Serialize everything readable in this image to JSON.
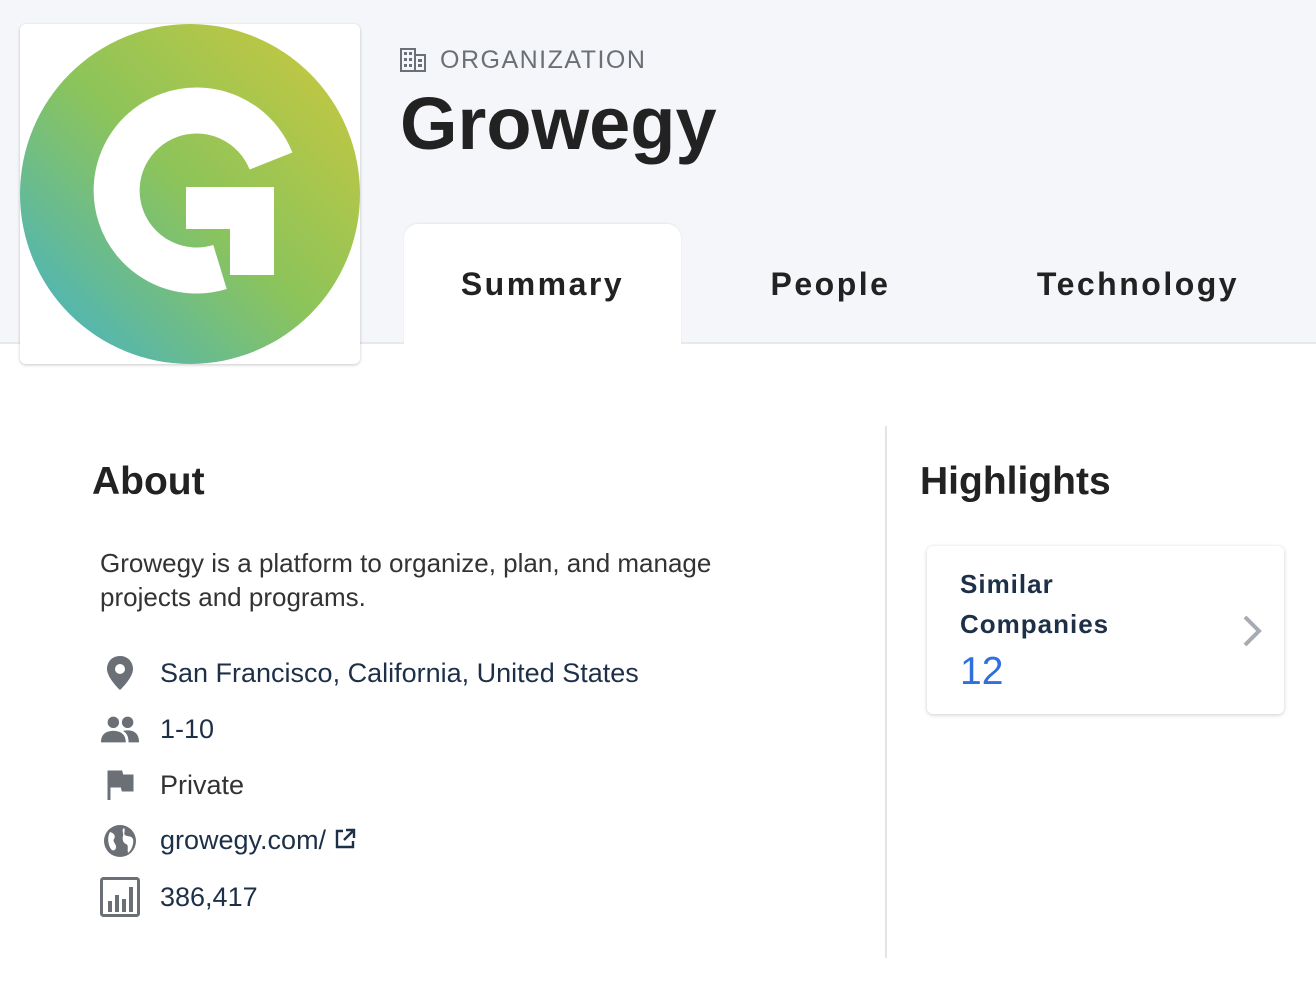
{
  "header": {
    "kind_label": "ORGANIZATION",
    "kind_icon": "building-icon",
    "name": "Growegy",
    "logo": {
      "letter": "G",
      "colors": [
        "#c8c83e",
        "#8cc453",
        "#4bb4c6"
      ]
    }
  },
  "tabs": [
    {
      "label": "Summary",
      "active": true
    },
    {
      "label": "People",
      "active": false
    },
    {
      "label": "Technology",
      "active": false
    }
  ],
  "about": {
    "title": "About",
    "description": "Growegy is a platform to organize, plan, and manage projects and programs.",
    "facts": [
      {
        "icon": "location-pin-icon",
        "value": "San Francisco, California, United States",
        "parts": [
          "San Francisco",
          "California",
          "United States"
        ]
      },
      {
        "icon": "people-icon",
        "value": "1-10"
      },
      {
        "icon": "flag-icon",
        "value": "Private"
      },
      {
        "icon": "globe-icon",
        "value": "growegy.com/",
        "link_icon": "external-link-icon"
      },
      {
        "icon": "bar-chart-icon",
        "value": "386,417"
      }
    ]
  },
  "highlights": {
    "title": "Highlights",
    "cards": [
      {
        "label": "Similar Companies",
        "value": "12",
        "icon": "chevron-right-icon"
      }
    ]
  },
  "colors": {
    "header_bg": "#f5f6fa",
    "link_text": "#1d3048",
    "accent_value": "#2f6fdf"
  }
}
